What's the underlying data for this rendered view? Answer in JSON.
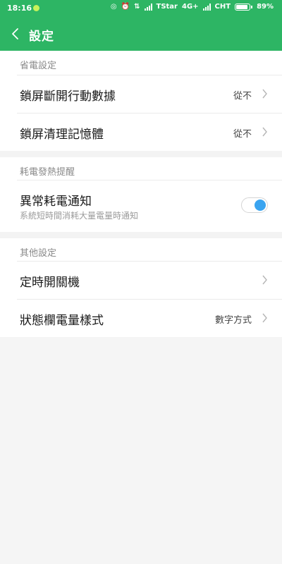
{
  "status_bar": {
    "time": "18:16",
    "carrier1": "TStar",
    "network1": "4G+",
    "carrier2": "CHT",
    "battery": "89%",
    "battery_level": 0.89
  },
  "header": {
    "title": "設定"
  },
  "sections": [
    {
      "title": "省電設定",
      "items": [
        {
          "label": "鎖屏斷開行動數據",
          "value": "從不"
        },
        {
          "label": "鎖屏清理記憶體",
          "value": "從不"
        }
      ]
    },
    {
      "title": "耗電發熱提醒",
      "items": [
        {
          "label": "異常耗電通知",
          "sublabel": "系統短時間消耗大量電量時通知",
          "toggle": true
        }
      ]
    },
    {
      "title": "其他設定",
      "items": [
        {
          "label": "定時開關機",
          "value": ""
        },
        {
          "label": "狀態欄電量樣式",
          "value": "數字方式"
        }
      ]
    }
  ],
  "colors": {
    "accent": "#2db564",
    "toggle_on": "#3aa4f0"
  }
}
